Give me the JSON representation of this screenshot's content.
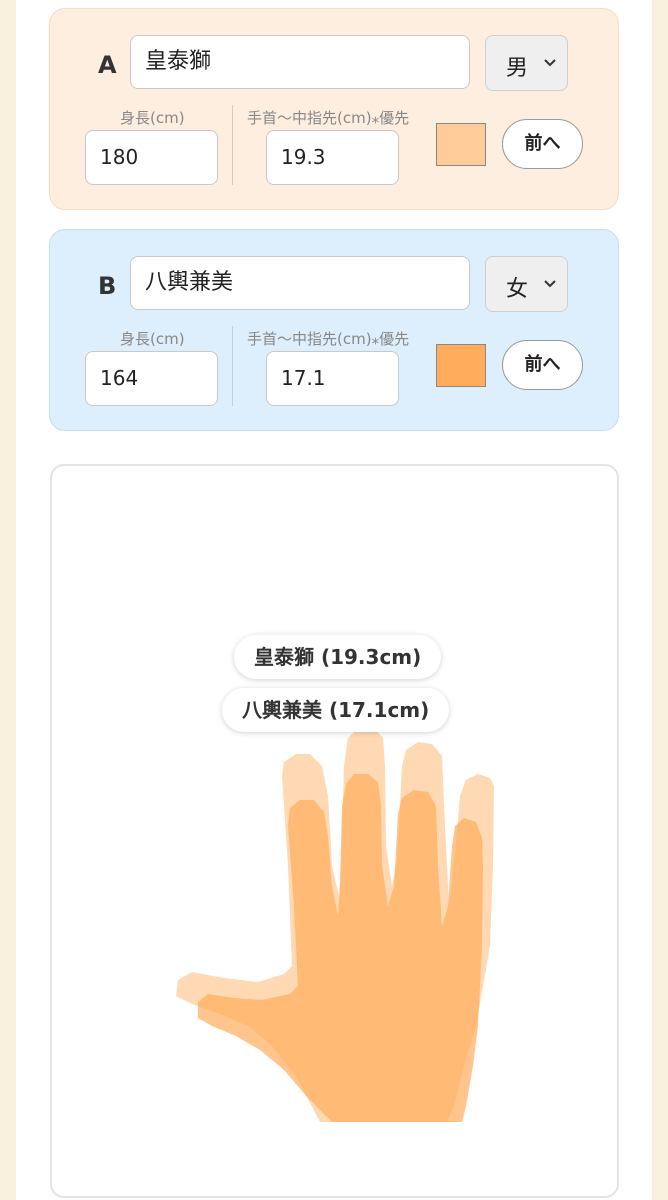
{
  "person_a": {
    "letter": "A",
    "name": "皇泰獅",
    "gender": "男",
    "height_label": "身長(cm)",
    "height_value": "180",
    "hand_label": "手首〜中指先(cm)⁎優先",
    "hand_value": "19.3",
    "color": "#ffcc99",
    "front_button": "前へ",
    "pill_label": "皇泰獅 (19.3cm)"
  },
  "person_b": {
    "letter": "B",
    "name": "八輿兼美",
    "gender": "女",
    "height_label": "身長(cm)",
    "height_value": "164",
    "hand_label": "手首〜中指先(cm)⁎優先",
    "hand_value": "17.1",
    "color": "#ffad5c",
    "front_button": "前へ",
    "pill_label": "八輿兼美 (17.1cm)"
  },
  "icons": {
    "dropdown": "chevron-down-icon"
  }
}
